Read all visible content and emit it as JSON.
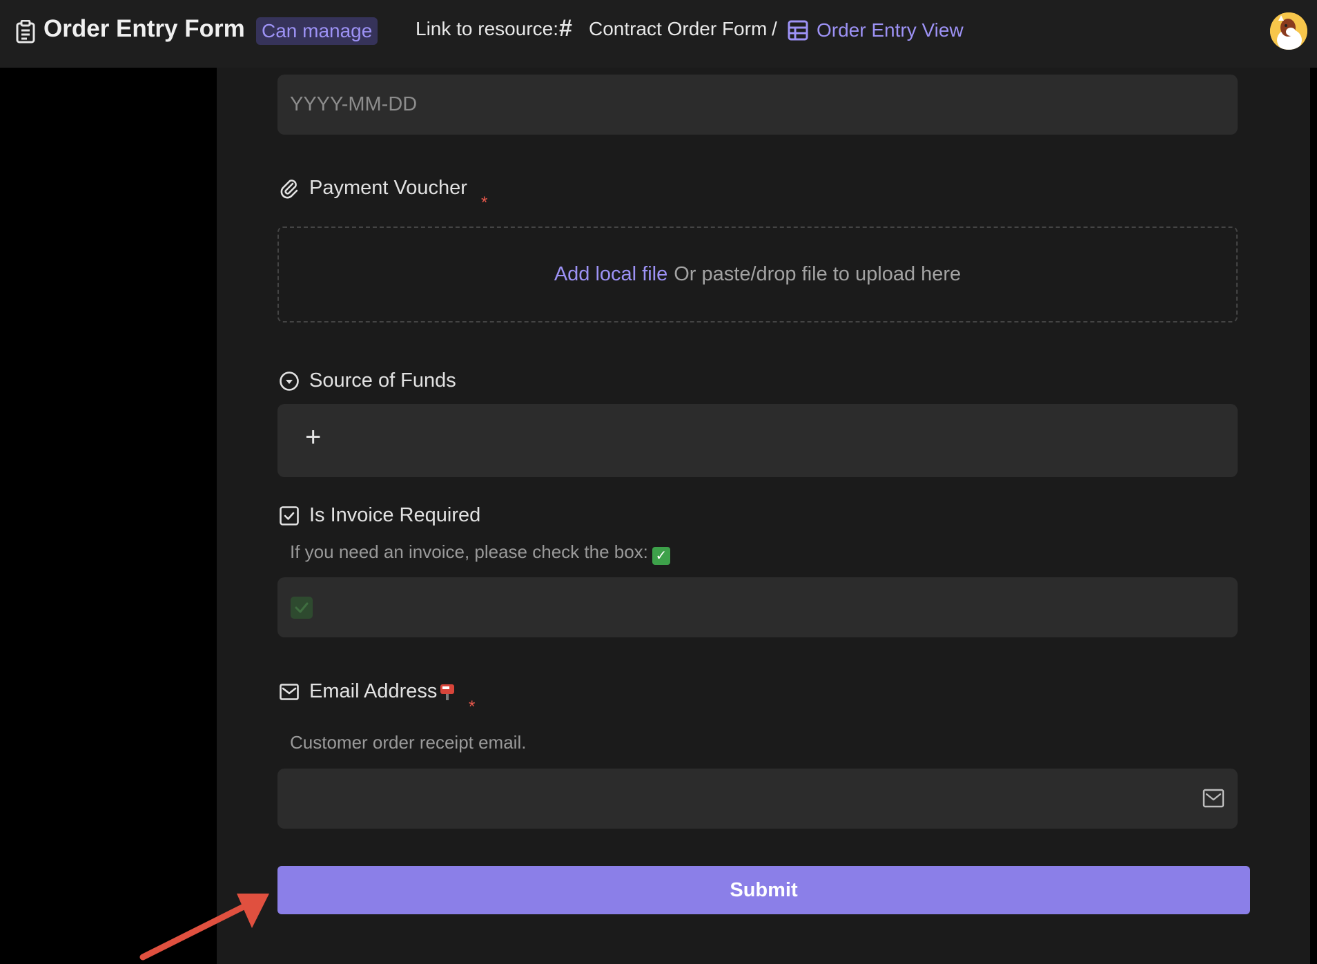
{
  "header": {
    "title": "Order Entry Form",
    "permission_badge": "Can manage",
    "link_label": "Link to resource:",
    "resource_name": "Contract Order Form",
    "separator": "/",
    "view_name": "Order Entry View"
  },
  "form": {
    "date_field": {
      "placeholder": "YYYY-MM-DD"
    },
    "payment_voucher": {
      "label": "Payment Voucher",
      "required_mark": "*",
      "add_file_link": "Add local file",
      "upload_hint": "Or paste/drop file to upload here"
    },
    "source_of_funds": {
      "label": "Source of Funds",
      "add_symbol": "+"
    },
    "invoice": {
      "label": "Is Invoice Required",
      "description": "If you need an invoice, please check the box:",
      "checked": true
    },
    "email": {
      "label": "Email Address",
      "required_mark": "*",
      "description": "Customer order receipt email.",
      "value": ""
    },
    "submit_label": "Submit"
  },
  "colors": {
    "accent": "#8b7fe8",
    "link": "#9d92f5",
    "required": "#e8584c",
    "annotation_arrow": "#e0503f"
  },
  "icons": [
    "form-icon",
    "hash-icon",
    "grid-view-icon",
    "avatar",
    "paperclip-icon",
    "dropdown-circle-icon",
    "checkbox-icon",
    "mail-icon"
  ]
}
